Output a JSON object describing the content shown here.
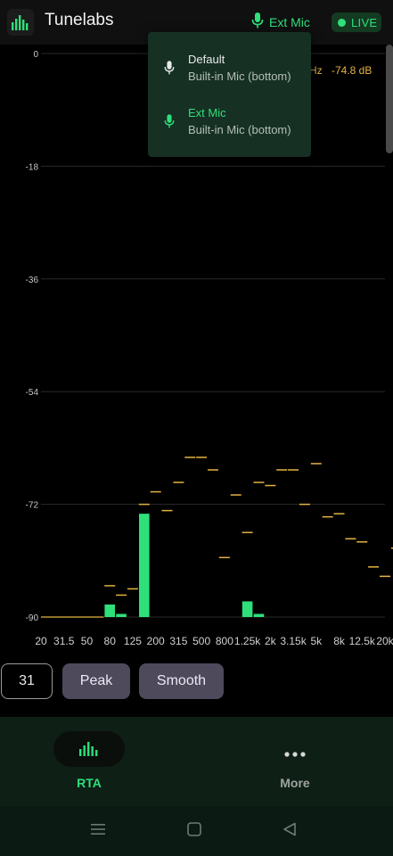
{
  "app": {
    "title": "Tunelabs",
    "icon": "equalizer-bars-icon"
  },
  "header": {
    "mic_label": "Ext Mic",
    "mic_icon": "microphone-icon",
    "live_label": "LIVE"
  },
  "readout": {
    "freq_partial": "Hz",
    "level": "-74.8 dB"
  },
  "mic_menu": {
    "items": [
      {
        "name": "Default",
        "device": "Built-in Mic (bottom)",
        "selected": false
      },
      {
        "name": "Ext Mic",
        "device": "Built-in Mic (bottom)",
        "selected": true
      }
    ]
  },
  "controls": {
    "bands": "31",
    "peak": "Peak",
    "smooth": "Smooth"
  },
  "nav": {
    "rta": "RTA",
    "more": "More"
  },
  "colors": {
    "accent": "#2ee07a",
    "peak": "#e3b341",
    "grid": "#2a2a2a",
    "chip": "#4e4a5c"
  },
  "chart_data": {
    "type": "bar",
    "title": "",
    "xlabel": "",
    "ylabel": "",
    "ylim": [
      -90,
      0
    ],
    "y_ticks": [
      "0",
      "-18",
      "-36",
      "-54",
      "-72",
      "-90"
    ],
    "x_tick_labels": [
      "20",
      "31.5",
      "50",
      "80",
      "125",
      "200",
      "315",
      "500",
      "800",
      "1.25k",
      "2k",
      "3.15k",
      "5k",
      "8k",
      "12.5k",
      "20k"
    ],
    "bands": [
      "20",
      "25",
      "31.5",
      "40",
      "50",
      "63",
      "80",
      "100",
      "125",
      "160",
      "200",
      "250",
      "315",
      "400",
      "500",
      "630",
      "800",
      "1k",
      "1.25k",
      "1.6k",
      "2k",
      "2.5k",
      "3.15k",
      "4k",
      "5k",
      "6.3k",
      "8k",
      "10k",
      "12.5k",
      "16k",
      "20k"
    ],
    "series": [
      {
        "values": [
          -90,
          -90,
          -90,
          -90,
          -90,
          -90,
          -88,
          -89.5,
          -90,
          -73.5,
          -90,
          -90,
          -90,
          -90,
          -90,
          -90,
          -90,
          -90,
          -87.5,
          -89.5,
          -90,
          -90,
          -90,
          -90,
          -90,
          -90,
          -90,
          -90,
          -90,
          -90,
          -90
        ]
      },
      {
        "values": [
          -90,
          -90,
          -90,
          -90,
          -90,
          -90,
          -85,
          -86.5,
          -85.5,
          -72,
          -70,
          -73,
          -68.5,
          -64.5,
          -64.5,
          -66.5,
          -80.5,
          -70.5,
          -76.5,
          -68.5,
          -69,
          -66.5,
          -66.5,
          -72,
          -65.5,
          -74,
          -73.5,
          -77.5,
          -78,
          -82,
          -83.5,
          -79
        ]
      }
    ],
    "grid": true,
    "legend": "none"
  }
}
